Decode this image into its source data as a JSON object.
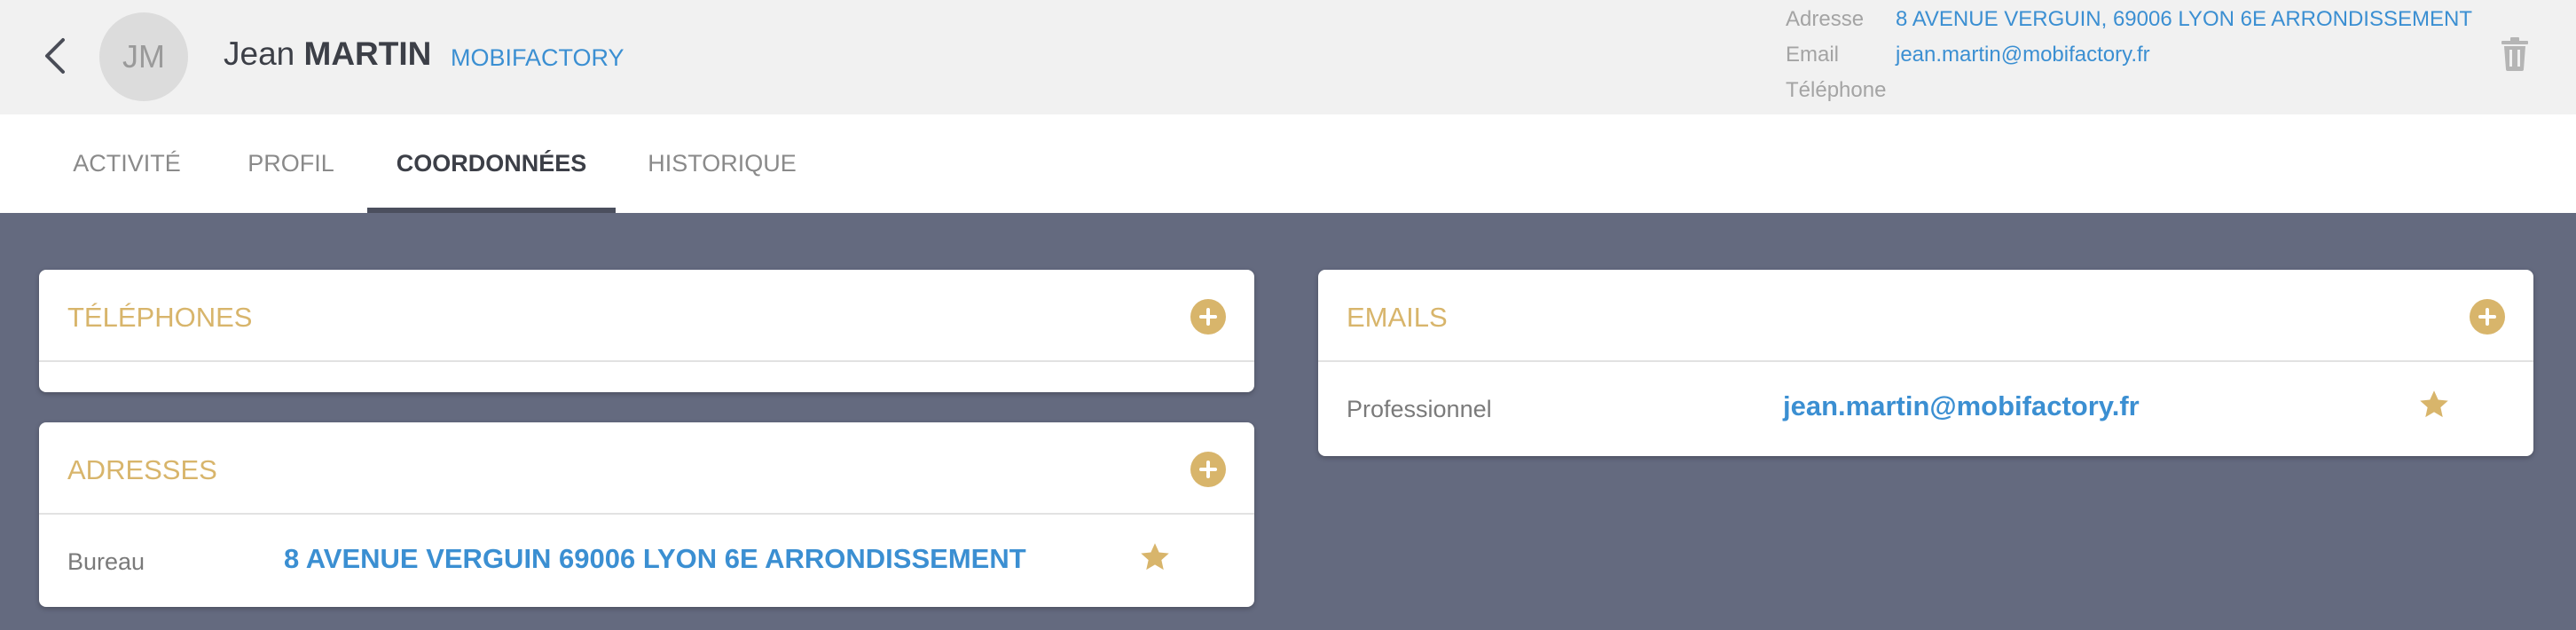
{
  "header": {
    "avatar_initials": "JM",
    "first_name": "Jean",
    "last_name": "MARTIN",
    "company": "MOBIFACTORY",
    "info": {
      "address_label": "Adresse",
      "address_value": "8 AVENUE VERGUIN, 69006 LYON 6E ARRONDISSEMENT",
      "email_label": "Email",
      "email_value": "jean.martin@mobifactory.fr",
      "phone_label": "Téléphone",
      "phone_value": ""
    },
    "icons": {
      "back": "chevron-left-icon",
      "delete": "trash-icon"
    }
  },
  "tabs": [
    {
      "label": "ACTIVITÉ",
      "active": false
    },
    {
      "label": "PROFIL",
      "active": false
    },
    {
      "label": "COORDONNÉES",
      "active": true
    },
    {
      "label": "HISTORIQUE",
      "active": false
    }
  ],
  "cards": {
    "phones": {
      "title": "TÉLÉPHONES",
      "items": []
    },
    "addresses": {
      "title": "ADRESSES",
      "items": [
        {
          "label": "Bureau",
          "value": "8 AVENUE VERGUIN 69006 LYON 6E ARRONDISSEMENT",
          "favorite": true
        }
      ]
    },
    "emails": {
      "title": "EMAILS",
      "items": [
        {
          "label": "Professionnel",
          "value": "jean.martin@mobifactory.fr",
          "favorite": true
        }
      ]
    }
  },
  "colors": {
    "accent_gold": "#d8b56b",
    "link_blue": "#3b8fd2",
    "background": "#646a7f",
    "header_bg": "#f1f1f1",
    "tab_indicator": "#4b4f5e"
  }
}
